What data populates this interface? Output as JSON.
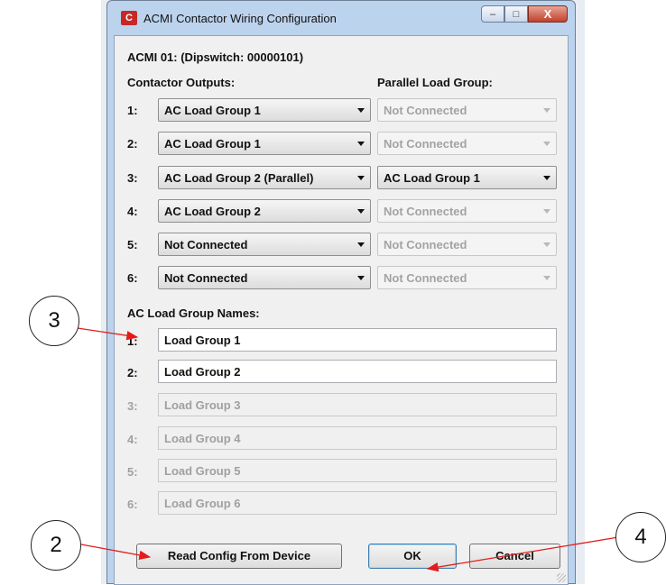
{
  "window": {
    "title": "ACMI Contactor Wiring Configuration",
    "app_icon_glyph": "C",
    "minimize_glyph": "–",
    "maximize_glyph": "□",
    "close_glyph": "X"
  },
  "device_header": "ACMI 01: (Dipswitch: 00000101)",
  "contactor_outputs_label": "Contactor Outputs:",
  "parallel_group_label": "Parallel Load Group:",
  "contactors": [
    {
      "index": "1:",
      "output": "AC Load Group 1",
      "parallel": "Not Connected",
      "parallel_enabled": false
    },
    {
      "index": "2:",
      "output": "AC Load Group 1",
      "parallel": "Not Connected",
      "parallel_enabled": false
    },
    {
      "index": "3:",
      "output": "AC Load Group 2 (Parallel)",
      "parallel": "AC Load Group 1",
      "parallel_enabled": true
    },
    {
      "index": "4:",
      "output": "AC Load Group 2",
      "parallel": "Not Connected",
      "parallel_enabled": false
    },
    {
      "index": "5:",
      "output": "Not Connected",
      "parallel": "Not Connected",
      "parallel_enabled": false
    },
    {
      "index": "6:",
      "output": "Not Connected",
      "parallel": "Not Connected",
      "parallel_enabled": false
    }
  ],
  "group_names_label": "AC Load Group Names:",
  "group_names": [
    {
      "index": "1:",
      "value": "Load Group 1",
      "enabled": true
    },
    {
      "index": "2:",
      "value": "Load Group 2",
      "enabled": true
    },
    {
      "index": "3:",
      "value": "Load Group 3",
      "enabled": false
    },
    {
      "index": "4:",
      "value": "Load Group 4",
      "enabled": false
    },
    {
      "index": "5:",
      "value": "Load Group 5",
      "enabled": false
    },
    {
      "index": "6:",
      "value": "Load Group 6",
      "enabled": false
    }
  ],
  "buttons": {
    "read_config": "Read Config From Device",
    "ok": "OK",
    "cancel": "Cancel"
  },
  "callouts": {
    "c2": "2",
    "c3": "3",
    "c4": "4"
  },
  "colors": {
    "annotation_arrow": "#e31b1b",
    "window_frame": "#bcd3ee"
  }
}
